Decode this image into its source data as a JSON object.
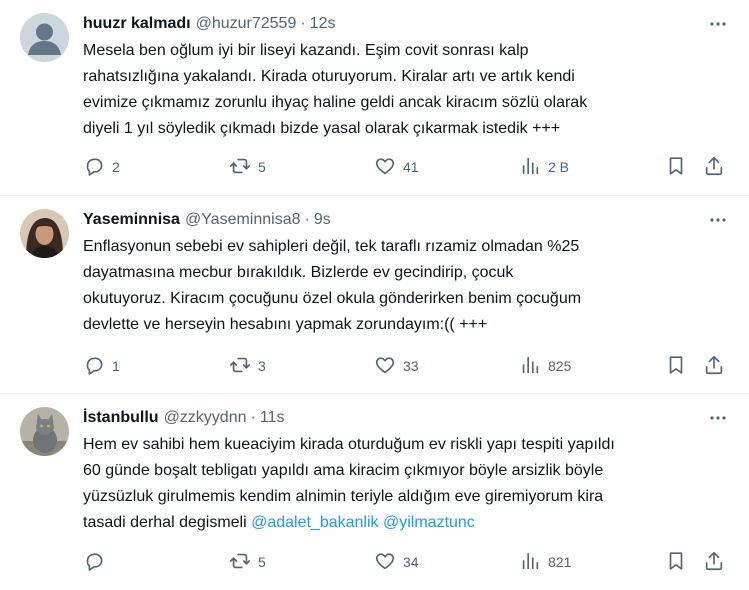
{
  "tweets": [
    {
      "name": "huuzr kalmadı",
      "handle": "@huzur72559",
      "dot": "·",
      "time": "12s",
      "text": "Mesela ben oğlum iyi bir liseyi kazandı. Eşim covit sonrası kalp\nrahatsızlığına  yakalandı. Kirada oturuyorum. Kiralar artı ve artık kendi\nevimize çıkmamız zorunlu ihyaç haline geldi ancak kiracım sözlü olarak\ndiyeli 1 yıl söyledik çıkmadı bizde yasal olarak çıkarmak istedik +++",
      "replies": "2",
      "reposts": "5",
      "likes": "41",
      "views": "2 B"
    },
    {
      "name": "Yaseminnisa",
      "handle": "@Yaseminnisa8",
      "dot": "·",
      "time": "9s",
      "text": "Enflasyonun sebebi ev sahipleri  değil,  tek taraflı  rızamiz  olmadan %25\ndayatmasına  mecbur  bırakıldık.  Bizlerde  ev gecindirip,  çocuk\nokutuyoruz.  Kiracım  çocuğunu  özel  okula  gönderirken  benim çocuğum\ndevlette ve herseyin  hesabını  yapmak  zorundayım:(( +++",
      "replies": "1",
      "reposts": "3",
      "likes": "33",
      "views": "825"
    },
    {
      "name": "İstanbullu",
      "handle": "@zzkyydnn",
      "dot": "·",
      "time": "11s",
      "text": "Hem ev sahibi hem kueaciyim kirada oturduğum ev riskli yapı tespiti yapıldı\n60 günde boşalt tebligatı yapıldı ama kiracim çıkmıyor böyle arsizlik böyle\nyüzsüzluk girulmemis kendim alnimin teriyle aldığım eve giremiyorum kira\ntasadi derhal degismeli ",
      "mention1": "@adalet_bakanlik",
      "mention2": "@yilmaztunc",
      "replies": "",
      "reposts": "5",
      "likes": "34",
      "views": "821"
    }
  ],
  "colors": {
    "text": "#0f1419",
    "secondary": "#536471",
    "link": "#1d9bf0",
    "divider": "#eff3f4"
  },
  "icons": [
    "more-icon",
    "reply-icon",
    "repost-icon",
    "like-icon",
    "views-icon",
    "bookmark-icon",
    "share-icon"
  ]
}
